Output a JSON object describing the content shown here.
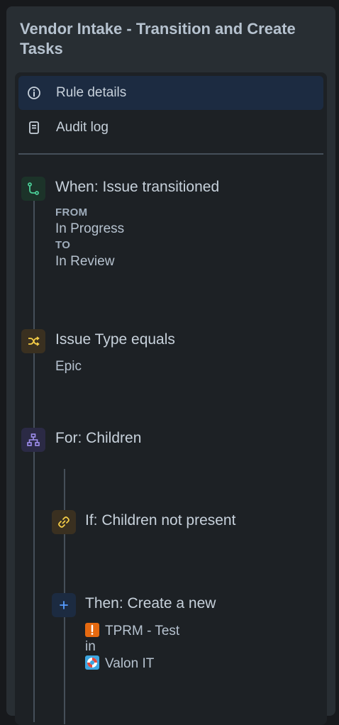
{
  "panel": {
    "title": "Vendor Intake - Transition and Create Tasks"
  },
  "menu": {
    "items": [
      {
        "label": "Rule details",
        "icon": "info-icon",
        "active": true
      },
      {
        "label": "Audit log",
        "icon": "document-icon",
        "active": false
      }
    ]
  },
  "steps": {
    "trigger": {
      "title": "When: Issue transitioned",
      "from_label": "FROM",
      "from_value": "In Progress",
      "to_label": "TO",
      "to_value": "In Review",
      "icon": "branch-icon",
      "color": "#4bce97"
    },
    "condition": {
      "title": "Issue Type equals",
      "value": "Epic",
      "icon": "shuffle-icon",
      "color": "#f5cd47"
    },
    "branch": {
      "title": "For: Children",
      "icon": "hierarchy-icon",
      "color": "#9f8fef"
    },
    "if_condition": {
      "title": "If: Children not present",
      "icon": "link-icon",
      "color": "#f5cd47"
    },
    "action": {
      "title": "Then: Create a new",
      "issue_type": "TPRM - Test",
      "in_label": "in",
      "project": "Valon IT",
      "icon": "plus-icon",
      "color": "#579dff"
    }
  },
  "colors": {
    "background": "#17191c",
    "panel": "#282e33",
    "inner": "#1d2125",
    "active_item": "#1c2b41"
  }
}
